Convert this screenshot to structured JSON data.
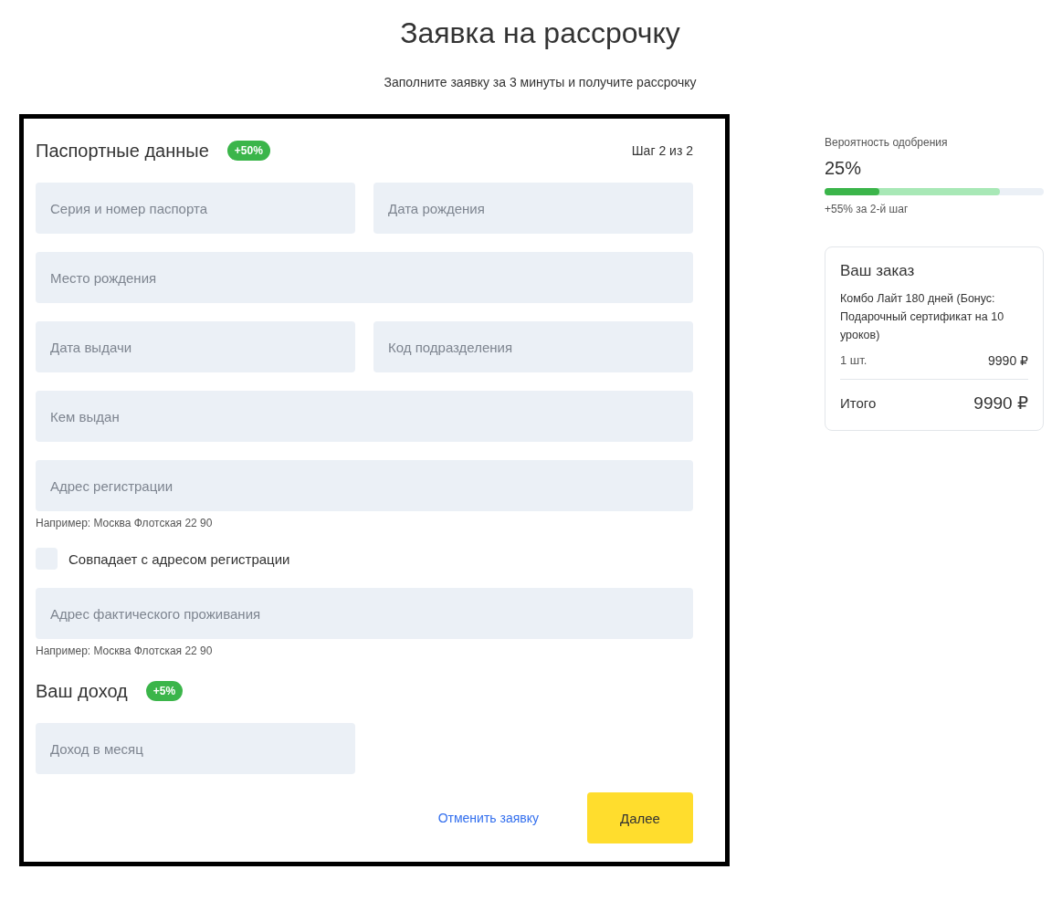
{
  "page": {
    "title": "Заявка на рассрочку",
    "subtitle": "Заполните заявку за 3 минуты и получите рассрочку"
  },
  "form": {
    "step": "Шаг 2 из 2",
    "sections": [
      {
        "title": "Паспортные данные",
        "badge": "+50%",
        "items": [
          {
            "kind": "row",
            "fields": [
              {
                "placeholder": "Серия и номер паспорта"
              },
              {
                "placeholder": "Дата рождения"
              }
            ]
          },
          {
            "kind": "row",
            "fields": [
              {
                "placeholder": "Место рождения"
              }
            ]
          },
          {
            "kind": "row",
            "fields": [
              {
                "placeholder": "Дата выдачи"
              },
              {
                "placeholder": "Код подразделения"
              }
            ]
          },
          {
            "kind": "row",
            "fields": [
              {
                "placeholder": "Кем выдан"
              }
            ]
          },
          {
            "kind": "row",
            "fields": [
              {
                "placeholder": "Адрес регистрации"
              }
            ],
            "hint": "Например: Москва Флотская 22 90"
          },
          {
            "kind": "checkbox",
            "label": "Совпадает с адресом регистрации",
            "checked": false
          },
          {
            "kind": "row",
            "fields": [
              {
                "placeholder": "Адрес фактического проживания"
              }
            ],
            "hint": "Например: Москва Флотская 22 90"
          }
        ]
      },
      {
        "title": "Ваш доход",
        "badge": "+5%",
        "items": [
          {
            "kind": "half",
            "fields": [
              {
                "placeholder": "Доход в месяц"
              }
            ]
          }
        ]
      }
    ],
    "cancel": "Отменить заявку",
    "next": "Далее"
  },
  "approval": {
    "label": "Вероятность одобрения",
    "value": "25%",
    "segments": [
      {
        "kind": "current",
        "level": 0.25
      },
      {
        "kind": "gain",
        "level": 0.8
      }
    ],
    "note": "+55% за 2-й шаг"
  },
  "order": {
    "title": "Ваш заказ",
    "item": "Комбо Лайт 180 дней (Бонус: Подарочный сертификат на 10 уроков)",
    "qty": "1 шт.",
    "price": "9990 ₽",
    "total_label": "Итого",
    "total": "9990 ₽"
  }
}
